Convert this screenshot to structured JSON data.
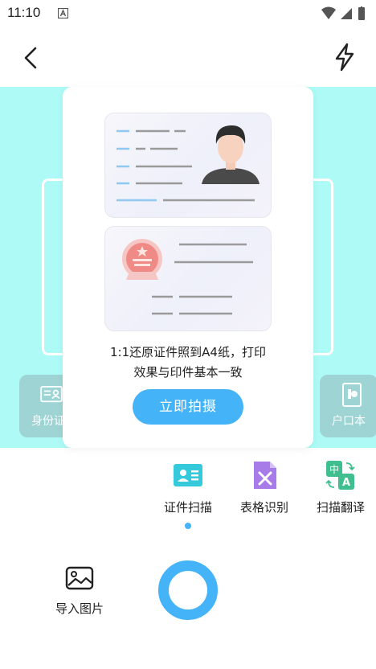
{
  "status_bar": {
    "time": "11:10"
  },
  "popup": {
    "description_line1": "1:1还原证件照到A4纸，打印",
    "description_line2": "效果与印件基本一致",
    "shoot_button_label": "立即拍摄"
  },
  "side_cards": {
    "left_label": "身份证",
    "right_label": "户口本"
  },
  "modes": [
    {
      "label": "证件扫描",
      "icon": "id-card-icon",
      "active": true
    },
    {
      "label": "表格识别",
      "icon": "spreadsheet-icon",
      "active": false
    },
    {
      "label": "扫描翻译",
      "icon": "translate-icon",
      "active": false
    }
  ],
  "bottom": {
    "import_label": "导入图片"
  },
  "colors": {
    "accent": "#45b3f7",
    "camera_bg": "#aefaf7"
  }
}
